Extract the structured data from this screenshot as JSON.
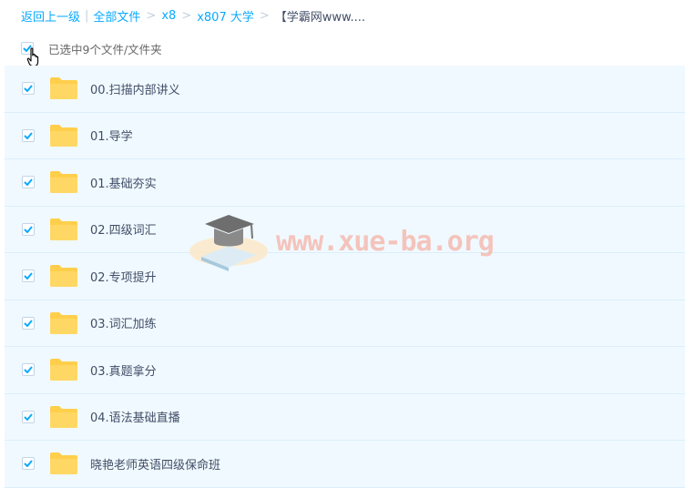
{
  "breadcrumb": {
    "back": "返回上一级",
    "all_files": "全部文件",
    "crumbs": [
      "x8",
      "x807 大学"
    ],
    "current": "【学霸网www...."
  },
  "selection": {
    "label": "已选中9个文件/文件夹",
    "all_checked": true
  },
  "files": [
    {
      "name": "00.扫描内部讲义",
      "checked": true
    },
    {
      "name": "01.导学",
      "checked": true
    },
    {
      "name": "01.基础夯实",
      "checked": true
    },
    {
      "name": "02.四级词汇",
      "checked": true
    },
    {
      "name": "02.专项提升",
      "checked": true
    },
    {
      "name": "03.词汇加练",
      "checked": true
    },
    {
      "name": "03.真题拿分",
      "checked": true
    },
    {
      "name": "04.语法基础直播",
      "checked": true
    },
    {
      "name": "晓艳老师英语四级保命班",
      "checked": true
    }
  ],
  "watermark": {
    "text": "www.xue-ba.org"
  },
  "colors": {
    "accent": "#09aaff",
    "row_bg": "#f0f9ff",
    "folder": "#ffcf4c",
    "watermark": "#f6b3a6"
  },
  "icons": {
    "checkbox": "checkbox-checked-icon",
    "folder": "folder-icon",
    "cursor": "hand-pointer-icon",
    "logo": "graduation-cap-logo"
  }
}
